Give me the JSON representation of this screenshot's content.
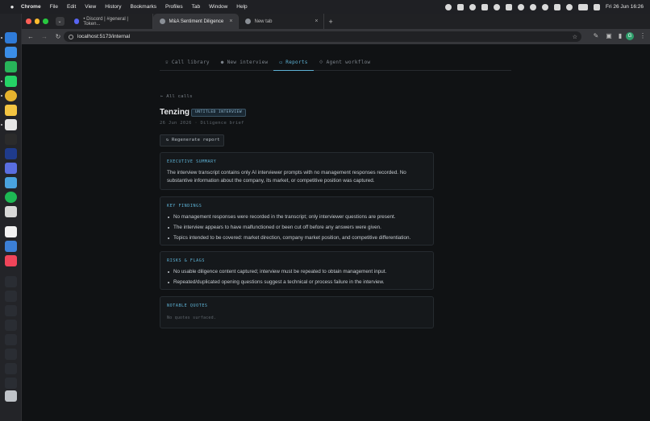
{
  "menubar": {
    "app": "Chrome",
    "items": [
      "File",
      "Edit",
      "View",
      "History",
      "Bookmarks",
      "Profiles",
      "Tab",
      "Window",
      "Help"
    ],
    "clock": "Fri 26 Jun  16:26"
  },
  "browser": {
    "tabs": [
      {
        "label": "• Discord | #general | Token..."
      },
      {
        "label": "M&A Sentiment Diligence"
      },
      {
        "label": "New tab"
      }
    ],
    "url": "localhost:5173/internal",
    "profile_initial": "G"
  },
  "nav": {
    "items": [
      {
        "label": "☏ Call library"
      },
      {
        "label": "● New interview"
      },
      {
        "label": "▭ Reports"
      },
      {
        "label": "⟐ Agent workflow"
      }
    ]
  },
  "report": {
    "back_label": "← All calls",
    "title": "Tenzing",
    "badge": "UNTITLED INTERVIEW",
    "meta": "26 Jun 2026 · Diligence brief",
    "regenerate_label": "↻ Regenerate report",
    "executive_summary": {
      "heading": "EXECUTIVE SUMMARY",
      "text": "The interview transcript contains only AI interviewer prompts with no management responses recorded. No substantive information about the company, its market, or competitive position was captured."
    },
    "key_findings": {
      "heading": "KEY FINDINGS",
      "items": [
        "No management responses were recorded in the transcript; only interviewer questions are present.",
        "The interview appears to have malfunctioned or been cut off before any answers were given.",
        "Topics intended to be covered: market direction, company market position, and competitive differentiation."
      ]
    },
    "risks": {
      "heading": "RISKS & FLAGS",
      "items": [
        "No usable diligence content captured; interview must be repeated to obtain management input.",
        "Repeated/duplicated opening questions suggest a technical or process failure in the interview."
      ]
    },
    "quotes": {
      "heading": "NOTABLE QUOTES",
      "empty": "No quotes surfaced."
    }
  },
  "colors": {
    "accent": "#5eb3d6",
    "background": "#101214",
    "card": "#15181b"
  }
}
